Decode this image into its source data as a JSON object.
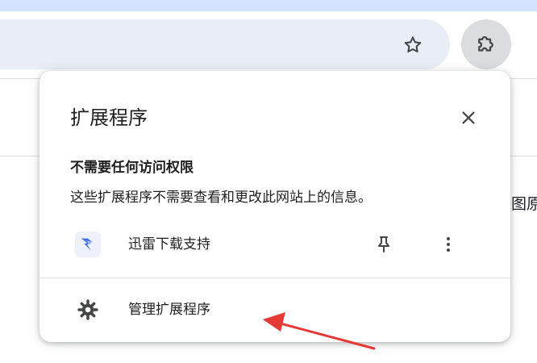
{
  "panel": {
    "title": "扩展程序",
    "section_heading": "不需要任何访问权限",
    "section_description": "这些扩展程序不需要查看和更改此网站上的信息。",
    "extensions": [
      {
        "name": "迅雷下载支持",
        "icon": "thunder-download-logo"
      }
    ],
    "manage_label": "管理扩展程序"
  },
  "page": {
    "right_text": "图原"
  },
  "icons": {
    "bookmark": "star-icon",
    "extensions": "puzzle-icon",
    "close": "close-icon",
    "pin": "pin-icon",
    "more": "more-vert-icon",
    "settings": "gear-icon"
  },
  "colors": {
    "top_strip": "#d3e3fd",
    "omnibox": "#e9eef6",
    "extension_button_active": "#dadce0",
    "text": "#1f1f1f",
    "icon": "#444746",
    "annotation_arrow": "#e53935",
    "thunder_logo": "#3f6ff0"
  }
}
